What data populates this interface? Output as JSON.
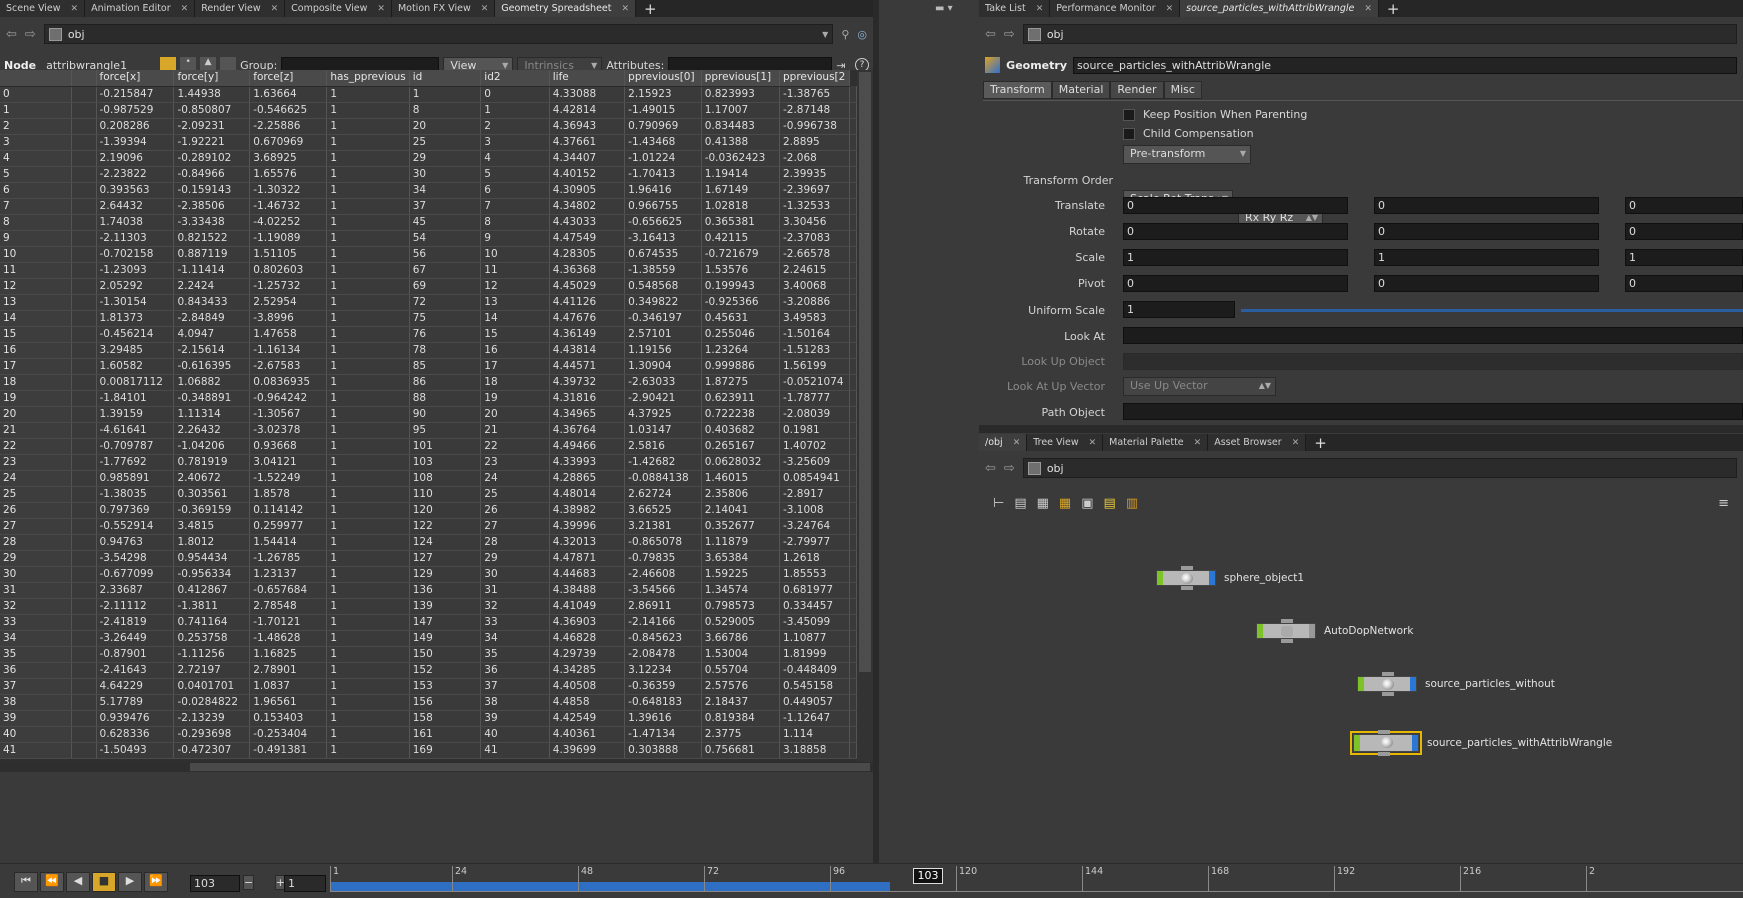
{
  "left_tabs": [
    "Scene View",
    "Animation Editor",
    "Render View",
    "Composite View",
    "Motion FX View",
    "Geometry Spreadsheet"
  ],
  "right_tabs": [
    "Take List",
    "Performance Monitor",
    "source_particles_withAttribWrangle"
  ],
  "left_path": "obj",
  "right_path": "obj",
  "toolbar": {
    "node_label": "Node",
    "node_name": "attribwrangle1",
    "group_label": "Group:",
    "view_label": "View",
    "intrinsics_label": "Intrinsics",
    "attributes_label": "Attributes:"
  },
  "columns": [
    "",
    "force[x]",
    "force[y]",
    "force[z]",
    "has_pprevious",
    "id",
    "id2",
    "life",
    "pprevious[0]",
    "pprevious[1]",
    "pprevious[2"
  ],
  "rows": [
    [
      "0",
      "-0.215847",
      "1.44938",
      "1.63664",
      "1",
      "1",
      "0",
      "4.33088",
      "2.15923",
      "0.823993",
      "-1.38765"
    ],
    [
      "1",
      "-0.987529",
      "-0.850807",
      "-0.546625",
      "1",
      "8",
      "1",
      "4.42814",
      "-1.49015",
      "1.17007",
      "-2.87148"
    ],
    [
      "2",
      "0.208286",
      "-2.09231",
      "-2.25886",
      "1",
      "20",
      "2",
      "4.36943",
      "0.790969",
      "0.834483",
      "-0.996738"
    ],
    [
      "3",
      "-1.39394",
      "-1.92221",
      "0.670969",
      "1",
      "25",
      "3",
      "4.37661",
      "-1.43468",
      "0.41388",
      "2.8895"
    ],
    [
      "4",
      "2.19096",
      "-0.289102",
      "3.68925",
      "1",
      "29",
      "4",
      "4.34407",
      "-1.01224",
      "-0.0362423",
      "-2.068"
    ],
    [
      "5",
      "-2.23822",
      "-0.84966",
      "1.65576",
      "1",
      "30",
      "5",
      "4.40152",
      "-1.70413",
      "1.19414",
      "2.39935"
    ],
    [
      "6",
      "0.393563",
      "-0.159143",
      "-1.30322",
      "1",
      "34",
      "6",
      "4.30905",
      "1.96416",
      "1.67149",
      "-2.39697"
    ],
    [
      "7",
      "2.64432",
      "-2.38506",
      "-1.46732",
      "1",
      "37",
      "7",
      "4.34802",
      "0.966755",
      "1.02818",
      "-1.32533"
    ],
    [
      "8",
      "1.74038",
      "-3.33438",
      "-4.02252",
      "1",
      "45",
      "8",
      "4.43033",
      "-0.656625",
      "0.365381",
      "3.30456"
    ],
    [
      "9",
      "-2.11303",
      "0.821522",
      "-1.19089",
      "1",
      "54",
      "9",
      "4.47549",
      "-3.16413",
      "0.42115",
      "-2.37083"
    ],
    [
      "10",
      "-0.702158",
      "0.887119",
      "1.51105",
      "1",
      "56",
      "10",
      "4.28305",
      "0.674535",
      "-0.721679",
      "-2.66578"
    ],
    [
      "11",
      "-1.23093",
      "-1.11414",
      "0.802603",
      "1",
      "67",
      "11",
      "4.36368",
      "-1.38559",
      "1.53576",
      "2.24615"
    ],
    [
      "12",
      "2.05292",
      "2.2424",
      "-1.25732",
      "1",
      "69",
      "12",
      "4.45029",
      "0.548568",
      "0.199943",
      "3.40068"
    ],
    [
      "13",
      "-1.30154",
      "0.843433",
      "2.52954",
      "1",
      "72",
      "13",
      "4.41126",
      "0.349822",
      "-0.925366",
      "-3.20886"
    ],
    [
      "14",
      "1.81373",
      "-2.84849",
      "-3.8996",
      "1",
      "75",
      "14",
      "4.47676",
      "-0.346197",
      "0.45631",
      "3.49583"
    ],
    [
      "15",
      "-0.456214",
      "4.0947",
      "1.47658",
      "1",
      "76",
      "15",
      "4.36149",
      "2.57101",
      "0.255046",
      "-1.50164"
    ],
    [
      "16",
      "3.29485",
      "-2.15614",
      "-1.16134",
      "1",
      "78",
      "16",
      "4.43814",
      "1.19156",
      "1.23264",
      "-1.51283"
    ],
    [
      "17",
      "1.60582",
      "-0.616395",
      "-2.67583",
      "1",
      "85",
      "17",
      "4.44571",
      "1.30904",
      "0.999886",
      "1.56199"
    ],
    [
      "18",
      "0.00817112",
      "1.06882",
      "0.0836935",
      "1",
      "86",
      "18",
      "4.39732",
      "-2.63033",
      "1.87275",
      "-0.0521074"
    ],
    [
      "19",
      "-1.84101",
      "-0.348891",
      "-0.964242",
      "1",
      "88",
      "19",
      "4.31816",
      "-2.90421",
      "0.623911",
      "-1.78777"
    ],
    [
      "20",
      "1.39159",
      "1.11314",
      "-1.30567",
      "1",
      "90",
      "20",
      "4.34965",
      "4.37925",
      "0.722238",
      "-2.08039"
    ],
    [
      "21",
      "-4.61641",
      "2.26432",
      "-3.02378",
      "1",
      "95",
      "21",
      "4.36764",
      "1.03147",
      "0.403682",
      "0.1981"
    ],
    [
      "22",
      "-0.709787",
      "-1.04206",
      "0.93668",
      "1",
      "101",
      "22",
      "4.49466",
      "2.5816",
      "0.265167",
      "1.40702"
    ],
    [
      "23",
      "-1.77692",
      "0.781919",
      "3.04121",
      "1",
      "103",
      "23",
      "4.33993",
      "-1.42682",
      "0.0628032",
      "-3.25609"
    ],
    [
      "24",
      "0.985891",
      "2.40672",
      "-1.52249",
      "1",
      "108",
      "24",
      "4.28865",
      "-0.0884138",
      "1.46015",
      "0.0854941"
    ],
    [
      "25",
      "-1.38035",
      "0.303561",
      "1.8578",
      "1",
      "110",
      "25",
      "4.48014",
      "2.62724",
      "2.35806",
      "-2.8917"
    ],
    [
      "26",
      "0.797369",
      "-0.369159",
      "0.114142",
      "1",
      "120",
      "26",
      "4.38982",
      "3.66525",
      "2.14041",
      "-3.1008"
    ],
    [
      "27",
      "-0.552914",
      "3.4815",
      "0.259977",
      "1",
      "122",
      "27",
      "4.39996",
      "3.21381",
      "0.352677",
      "-3.24764"
    ],
    [
      "28",
      "0.94763",
      "1.8012",
      "1.54414",
      "1",
      "124",
      "28",
      "4.32013",
      "-0.865078",
      "1.11879",
      "-2.79977"
    ],
    [
      "29",
      "-3.54298",
      "0.954434",
      "-1.26785",
      "1",
      "127",
      "29",
      "4.47871",
      "-0.79835",
      "3.65384",
      "1.2618"
    ],
    [
      "30",
      "-0.677099",
      "-0.956334",
      "1.23137",
      "1",
      "129",
      "30",
      "4.44683",
      "-2.46608",
      "1.59225",
      "1.85553"
    ],
    [
      "31",
      "2.33687",
      "0.412867",
      "-0.657684",
      "1",
      "136",
      "31",
      "4.38488",
      "-3.54566",
      "1.34574",
      "0.681977"
    ],
    [
      "32",
      "-2.11112",
      "-1.3811",
      "2.78548",
      "1",
      "139",
      "32",
      "4.41049",
      "2.86911",
      "0.798573",
      "0.334457"
    ],
    [
      "33",
      "-2.41819",
      "0.741164",
      "-1.70121",
      "1",
      "147",
      "33",
      "4.36903",
      "-2.14166",
      "0.529005",
      "-3.45099"
    ],
    [
      "34",
      "-3.26449",
      "0.253758",
      "-1.48628",
      "1",
      "149",
      "34",
      "4.46828",
      "-0.845623",
      "3.66786",
      "1.10877"
    ],
    [
      "35",
      "-0.87901",
      "-1.11256",
      "1.16825",
      "1",
      "150",
      "35",
      "4.29739",
      "-2.08478",
      "1.53004",
      "1.81999"
    ],
    [
      "36",
      "-2.41643",
      "2.72197",
      "2.78901",
      "1",
      "152",
      "36",
      "4.34285",
      "3.12234",
      "0.55704",
      "-0.448409"
    ],
    [
      "37",
      "4.64229",
      "0.0401701",
      "1.0837",
      "1",
      "153",
      "37",
      "4.40508",
      "-0.36359",
      "2.57576",
      "0.545158"
    ],
    [
      "38",
      "5.17789",
      "-0.0284822",
      "1.96561",
      "1",
      "156",
      "38",
      "4.4858",
      "-0.648183",
      "2.18437",
      "0.449057"
    ],
    [
      "39",
      "0.939476",
      "-2.13239",
      "0.153403",
      "1",
      "158",
      "39",
      "4.42549",
      "1.39616",
      "0.819384",
      "-1.12647"
    ],
    [
      "40",
      "0.628336",
      "-0.293698",
      "-0.253404",
      "1",
      "161",
      "40",
      "4.40361",
      "-1.47134",
      "2.3775",
      "1.114"
    ],
    [
      "41",
      "-1.50493",
      "-0.472307",
      "-0.491381",
      "1",
      "169",
      "41",
      "4.39699",
      "0.303888",
      "0.756681",
      "3.18858"
    ]
  ],
  "params": {
    "geo_label": "Geometry",
    "geo_name": "source_particles_withAttribWrangle",
    "tabs": [
      "Transform",
      "Material",
      "Render",
      "Misc"
    ],
    "keep_position": "Keep Position When Parenting",
    "child_comp": "Child Compensation",
    "pre_transform": "Pre-transform",
    "xform_order_label": "Transform Order",
    "xform_order": "Scale Rot Trans",
    "rot_order": "Rx Ry Rz",
    "translate_label": "Translate",
    "translate": [
      "0",
      "0",
      "0"
    ],
    "rotate_label": "Rotate",
    "rotate": [
      "0",
      "0",
      "0"
    ],
    "scale_label": "Scale",
    "scale": [
      "1",
      "1",
      "1"
    ],
    "pivot_label": "Pivot",
    "pivot": [
      "0",
      "0",
      "0"
    ],
    "uniform_label": "Uniform Scale",
    "uniform": "1",
    "lookat_label": "Look At",
    "lookup_label": "Look Up Object",
    "lookatup_label": "Look At Up Vector",
    "lookatup_value": "Use Up Vector",
    "path_label": "Path Object"
  },
  "net_tabs": [
    "/obj",
    "Tree View",
    "Material Palette",
    "Asset Browser"
  ],
  "net_path": "obj",
  "nodes": [
    "sphere_object1",
    "AutoDopNetwork",
    "source_particles_without",
    "source_particles_withAttribWrangle"
  ],
  "playbar": {
    "frame": "103",
    "step": "1",
    "current": "103",
    "ticks": [
      "1",
      "24",
      "48",
      "72",
      "96",
      "120",
      "144",
      "168",
      "192",
      "216",
      "2"
    ]
  }
}
